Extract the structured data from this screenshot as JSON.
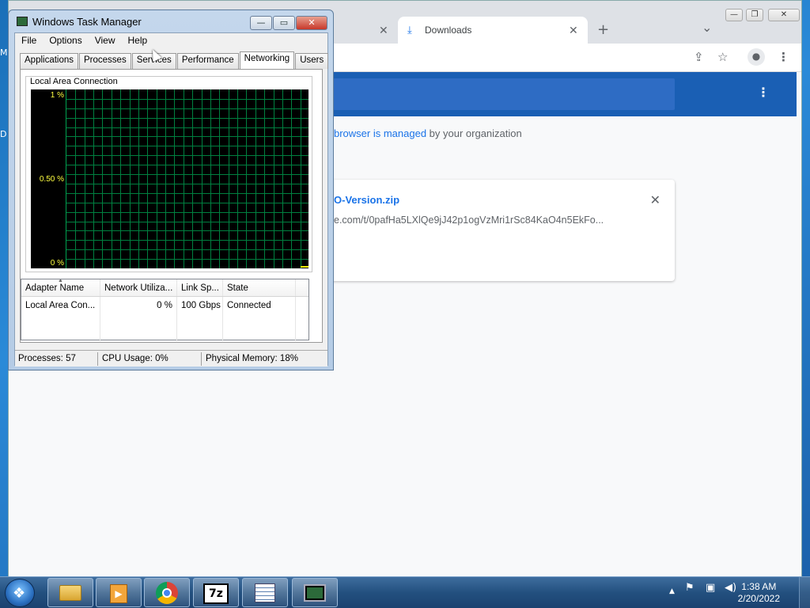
{
  "desktop": {
    "frag1": "M",
    "frag2": "D"
  },
  "chrome": {
    "tabs": [
      {
        "label": "",
        "close": "✕"
      },
      {
        "label": "Downloads",
        "close": "✕"
      }
    ],
    "new_tab": "+",
    "tab_search": "⌄",
    "window_buttons": {
      "minimize": "—",
      "maximize": "❐",
      "close": "✕"
    },
    "toolbar": {
      "share": "⇪",
      "star": "☆",
      "profile": "●",
      "menu": "⋮"
    },
    "downloads": {
      "menu_icon": "⋮",
      "managed_link": "browser is managed",
      "managed_rest": " by your organization",
      "item_name": "O-Version.zip",
      "item_url": "e.com/t/0pafHa5LXlQe9jJ42p1ogVzMri1rSc84KaO4n5EkFo...",
      "item_close": "✕"
    }
  },
  "taskmanager": {
    "title": "Windows Task Manager",
    "buttons": {
      "minimize": "—",
      "maximize": "▭",
      "close": "✕"
    },
    "menu": [
      "File",
      "Options",
      "View",
      "Help"
    ],
    "tabs": [
      "Applications",
      "Processes",
      "Services",
      "Performance",
      "Networking",
      "Users"
    ],
    "active_tab": "Networking",
    "graph": {
      "caption": "Local Area Connection",
      "y_labels": [
        "1 %",
        "0.50 %",
        "0 %"
      ],
      "utilization_percent": 0
    },
    "columns": [
      "Adapter Name",
      "Network Utiliza...",
      "Link Sp...",
      "State"
    ],
    "rows": [
      {
        "adapter": "Local Area Con...",
        "utilization": "0 %",
        "speed": "100 Gbps",
        "state": "Connected"
      }
    ],
    "status": {
      "processes": "Processes: 57",
      "cpu": "CPU Usage: 0%",
      "memory": "Physical Memory: 18%"
    }
  },
  "taskbar": {
    "items": [
      "explorer-icon",
      "media-player-icon",
      "chrome-icon",
      "7zip-icon",
      "notepad-icon",
      "taskmanager-icon"
    ],
    "seven_zip_label": "7z",
    "tray": {
      "expand": "▲"
    },
    "clock": {
      "time": "1:38 AM",
      "date": "2/20/2022"
    }
  }
}
